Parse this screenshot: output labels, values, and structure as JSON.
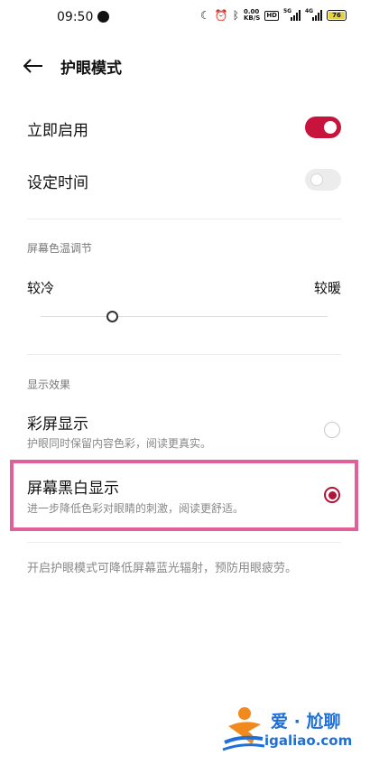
{
  "status_bar": {
    "time": "09:50",
    "net_speed_value": "0.00",
    "net_speed_unit": "KB/S",
    "hd_label": "HD",
    "sim1_gen": "5G",
    "sim2_gen": "4G",
    "battery_level": "76"
  },
  "header": {
    "title": "护眼模式"
  },
  "settings": {
    "enable_label": "立即启用",
    "enable_on": true,
    "schedule_label": "设定时间",
    "schedule_on": false
  },
  "color_temp": {
    "section_title": "屏幕色温调节",
    "cool_label": "较冷",
    "warm_label": "较暖",
    "slider_fraction": 0.25
  },
  "display_effect": {
    "section_title": "显示效果",
    "options": [
      {
        "title": "彩屏显示",
        "desc": "护眼同时保留内容色彩，阅读更真实。",
        "selected": false
      },
      {
        "title": "屏幕黑白显示",
        "desc": "进一步降低色彩对眼睛的刺激，阅读更舒适。",
        "selected": true
      }
    ]
  },
  "footer_note": "开启护眼模式可降低屏幕蓝光辐射，预防用眼疲劳。",
  "watermark": {
    "text": "爱 · 尬聊",
    "url": "igaliao.com"
  },
  "colors": {
    "accent": "#c8143c",
    "highlight": "#e0609a",
    "watermark_blue": "#1f6fd6"
  }
}
